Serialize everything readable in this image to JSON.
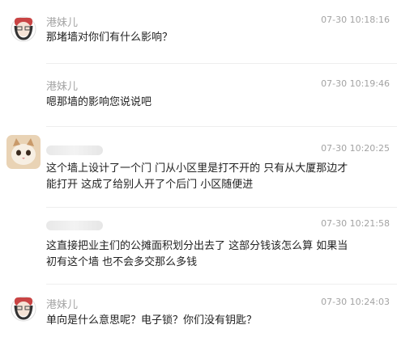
{
  "comments": [
    {
      "user": "港妹儿",
      "time": "07-30 10:18:16",
      "text": "那堵墙对你们有什么影响？"
    },
    {
      "user": "港妹儿",
      "time": "07-30 10:19:46",
      "text": "嗯那墙的影响您说说吧"
    },
    {
      "user": "",
      "time": "07-30 10:20:25",
      "text_line1": "这个墙上设计了一个门 门从小区里是打不开的 只有从大厦那边才",
      "text_line2": "能打开 这成了给别人开了个后门 小区随便进"
    },
    {
      "user": "",
      "time": "07-30 10:21:58",
      "text_line1": "这直接把业主们的公摊面积划分出去了 这部分钱该怎么算 如果当",
      "text_line2": "初有这个墙 也不会多交那么多钱"
    },
    {
      "user": "港妹儿",
      "time": "07-30 10:24:03",
      "text": "单向是什么意思呢？电子锁？你们没有钥匙？"
    }
  ]
}
